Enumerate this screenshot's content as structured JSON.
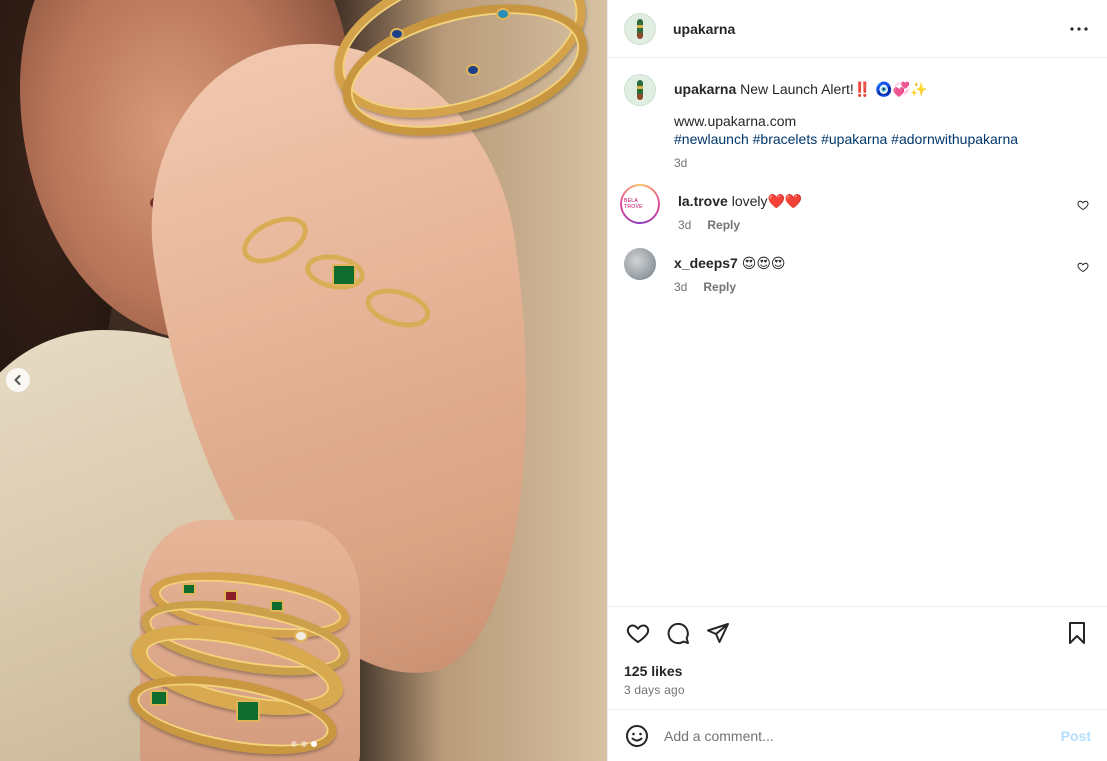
{
  "post": {
    "author": "upakarna",
    "avatar_icon": "upakarna-logo-icon"
  },
  "header": {
    "username": "upakarna",
    "more_icon": "more-options-icon"
  },
  "caption": {
    "username": "upakarna",
    "text": "New Launch Alert!‼️ 🧿💞✨",
    "link": "www.upakarna.com",
    "hashtags": [
      "#newlaunch",
      "#bracelets",
      "#upakarna",
      "#adornwithupakarna"
    ],
    "time": "3d"
  },
  "comments": [
    {
      "username": "la.trove",
      "text": "lovely❤️❤️",
      "time": "3d",
      "reply_label": "Reply",
      "avatar_text": "BELA TROVE"
    },
    {
      "username": "x_deeps7",
      "text": "😍😍😍",
      "time": "3d",
      "reply_label": "Reply"
    }
  ],
  "engagement": {
    "likes": "125 likes",
    "posted_ago": "3 days ago"
  },
  "composer": {
    "placeholder": "Add a comment...",
    "post_label": "Post"
  },
  "carousel": {
    "slide_count": 3,
    "active_index": 2
  },
  "colors": {
    "link": "#00376b",
    "muted": "#737373",
    "post_disabled": "#b2dffc",
    "border": "#efefef"
  }
}
